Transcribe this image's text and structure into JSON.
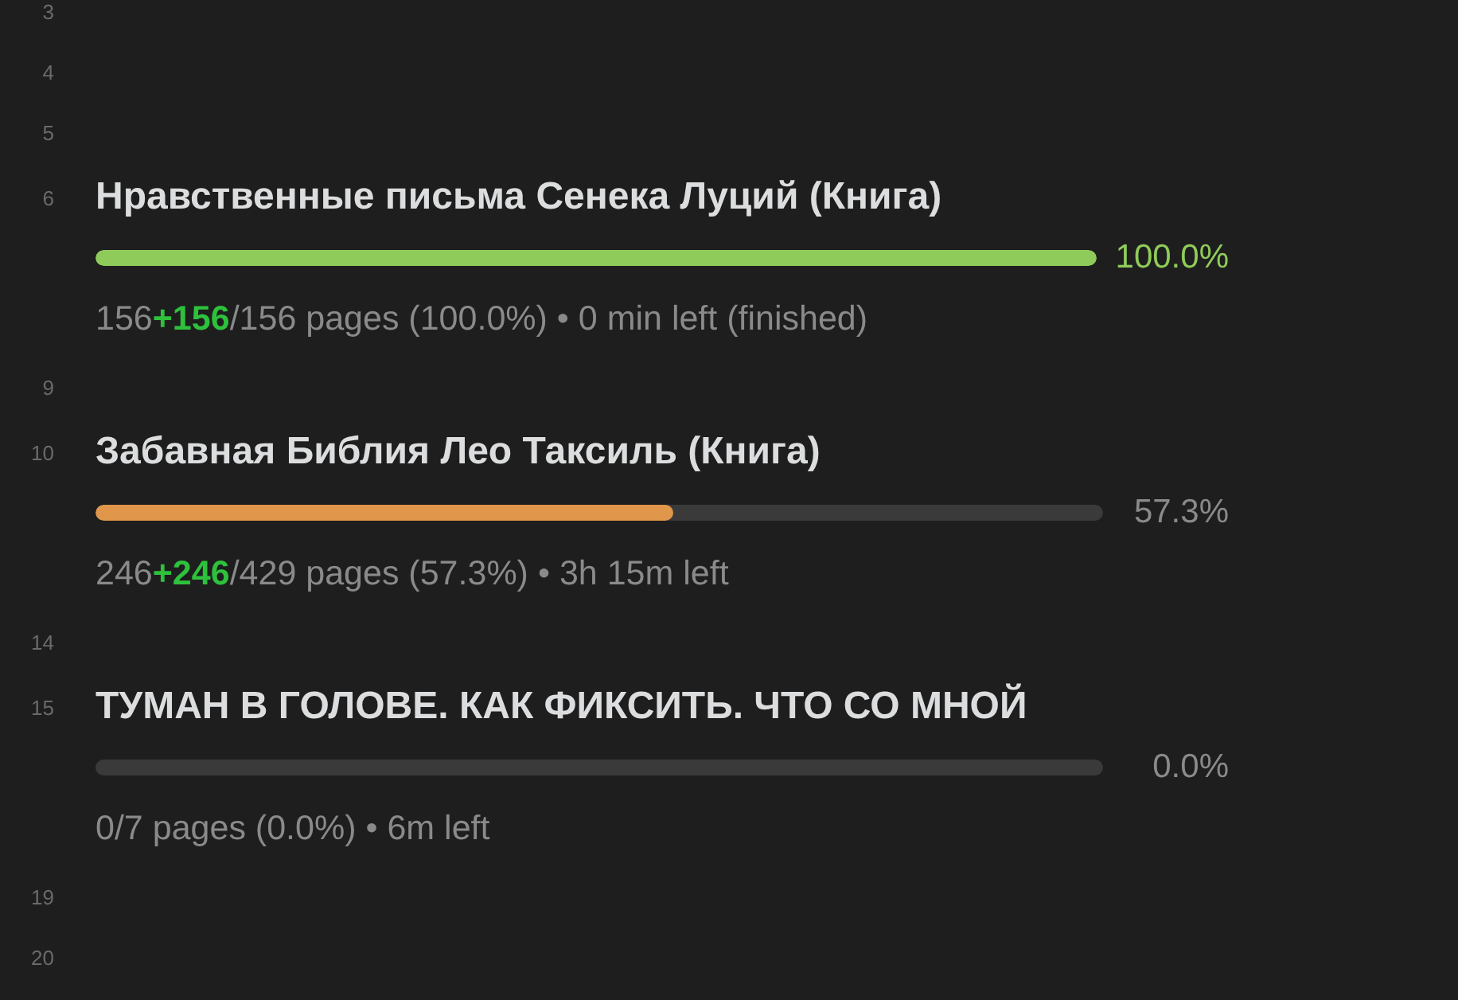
{
  "editor": {
    "lines": [
      {
        "kind": "empty",
        "line_number": "3"
      },
      {
        "kind": "empty",
        "line_number": "4"
      },
      {
        "kind": "empty",
        "line_number": "5"
      },
      {
        "kind": "book",
        "line_number": "6",
        "title": "Нравственные письма Сенека Луций (Книга)",
        "level": 1,
        "color": "#8fcb5a",
        "percent": "100.0%",
        "finished": true,
        "stats": "156**+156**/156 pages (100.0%) • 0 min left (finished)"
      },
      {
        "kind": "empty",
        "line_number": "9"
      },
      {
        "kind": "book",
        "line_number": "10",
        "title": "Забавная Библия Лео Таксиль (Книга)",
        "level": 0.573,
        "color": "#e0974b",
        "percent": "57.3%",
        "finished": false,
        "stats": "246**+246**/429 pages (57.3%) • 3h 15m left"
      },
      {
        "kind": "empty",
        "line_number": "14"
      },
      {
        "kind": "book",
        "line_number": "15",
        "title": "ТУМАН В ГОЛОВЕ. КАК ФИКСИТЬ. ЧТО СО МНОЙ",
        "percent": "0.0%",
        "finished": false,
        "stats": "0/7 pages (0.0%) • 6m left"
      },
      {
        "kind": "empty",
        "line_number": "19"
      },
      {
        "kind": "empty",
        "line_number": "20"
      }
    ]
  }
}
